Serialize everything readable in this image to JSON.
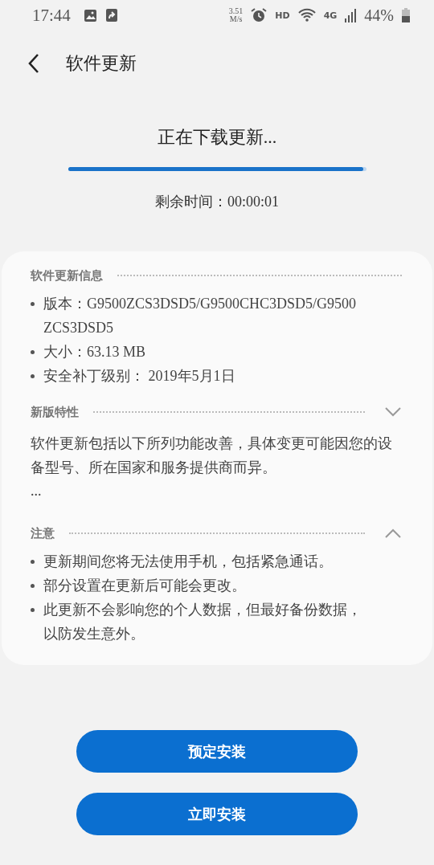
{
  "status_bar": {
    "time": "17:44",
    "speed": "3.51",
    "speed_unit": "M/s",
    "hd": "HD",
    "network": "4G",
    "battery": "44%"
  },
  "header": {
    "title": "软件更新"
  },
  "download": {
    "status": "正在下载更新...",
    "level": 0.99,
    "remaining": "剩余时间：00:00:01"
  },
  "info": {
    "title": "软件更新信息",
    "items": [
      "版本：G9500ZCS3DSD5/G9500CHC3DSD5/G9500ZCS3DSD5",
      "大小：63.13 MB",
      "安全补丁级别： 2019年5月1日"
    ]
  },
  "sections": [
    {
      "title": "新版特性",
      "expanded": false,
      "kind": "paragraph",
      "text": "软件更新包括以下所列功能改善，具体变更可能因您的设备型号、所在国家和服务提供商而异。",
      "more": "..."
    },
    {
      "title": "注意",
      "expanded": true,
      "kind": "list",
      "items": [
        "更新期间您将无法使用手机，包括紧急通话。",
        "部分设置在更新后可能会更改。",
        "此更新不会影响您的个人数据，但最好备份数据，以防发生意外。"
      ]
    }
  ],
  "buttons": [
    "预定安装",
    "立即安装"
  ]
}
